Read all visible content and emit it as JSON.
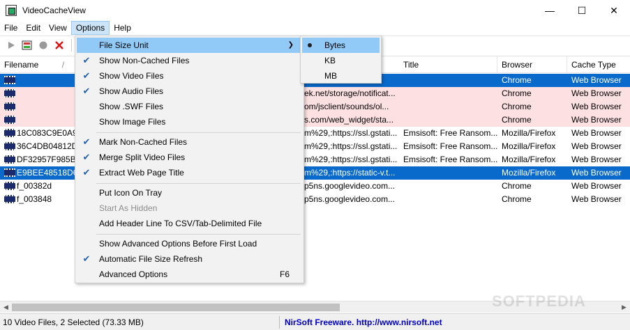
{
  "window": {
    "title": "VideoCacheView",
    "controls": {
      "minimize": "—",
      "maximize": "☐",
      "close": "✕"
    }
  },
  "menubar": {
    "items": [
      "File",
      "Edit",
      "View",
      "Options",
      "Help"
    ],
    "active": "Options"
  },
  "toolbar": {
    "icons": [
      "play-icon",
      "save-icon",
      "stop-icon",
      "delete-icon"
    ]
  },
  "table": {
    "columns": [
      "Filename",
      "Title",
      "Browser",
      "Cache Type"
    ],
    "sort_indicator": "/",
    "rows": [
      {
        "filename": "",
        "url": "m...",
        "title": "",
        "browser": "Chrome",
        "cache_type": "Web Browser",
        "state": "selected"
      },
      {
        "filename": "",
        "url": "ek.net/storage/notificat...",
        "title": "",
        "browser": "Chrome",
        "cache_type": "Web Browser",
        "state": "pink"
      },
      {
        "filename": "",
        "url": "om/jsclient/sounds/ol...",
        "title": "",
        "browser": "Chrome",
        "cache_type": "Web Browser",
        "state": "pink"
      },
      {
        "filename": "",
        "url": "s.com/web_widget/sta...",
        "title": "",
        "browser": "Chrome",
        "cache_type": "Web Browser",
        "state": "pink"
      },
      {
        "filename": "18C083C9E0A92",
        "url": "m%29,:https://ssl.gstati...",
        "title": "Emsisoft: Free Ransom...",
        "browser": "Mozilla/Firefox",
        "cache_type": "Web Browser",
        "state": "normal"
      },
      {
        "filename": "36C4DB04812D0",
        "url": "m%29,:https://ssl.gstati...",
        "title": "Emsisoft: Free Ransom...",
        "browser": "Mozilla/Firefox",
        "cache_type": "Web Browser",
        "state": "normal"
      },
      {
        "filename": "DF32957F985B5",
        "url": "m%29,:https://ssl.gstati...",
        "title": "Emsisoft: Free Ransom...",
        "browser": "Mozilla/Firefox",
        "cache_type": "Web Browser",
        "state": "normal"
      },
      {
        "filename": "E9BEE48518D6A",
        "url": "m%29,:https://static-v.t...",
        "title": "",
        "browser": "Mozilla/Firefox",
        "cache_type": "Web Browser",
        "state": "selected"
      },
      {
        "filename": "f_00382d",
        "url": "p5ns.googlevideo.com...",
        "title": "",
        "browser": "Chrome",
        "cache_type": "Web Browser",
        "state": "normal"
      },
      {
        "filename": "f_003848",
        "url": "p5ns.googlevideo.com...",
        "title": "",
        "browser": "Chrome",
        "cache_type": "Web Browser",
        "state": "normal"
      }
    ]
  },
  "options_menu": {
    "items": [
      {
        "label": "File Size Unit",
        "checked": false,
        "submenu": true,
        "highlighted": true
      },
      {
        "label": "Show Non-Cached Files",
        "checked": true
      },
      {
        "label": "Show Video Files",
        "checked": true
      },
      {
        "label": "Show Audio Files",
        "checked": true
      },
      {
        "label": "Show .SWF Files",
        "checked": false
      },
      {
        "label": "Show Image Files",
        "checked": false
      },
      {
        "label": "Mark Non-Cached Files",
        "checked": true
      },
      {
        "label": "Merge Split Video Files",
        "checked": true
      },
      {
        "label": "Extract Web Page Title",
        "checked": true
      },
      {
        "label": "Put Icon On Tray",
        "checked": false
      },
      {
        "label": "Start As Hidden",
        "checked": false,
        "disabled": true
      },
      {
        "label": "Add Header Line To CSV/Tab-Delimited File",
        "checked": false
      },
      {
        "label": "Show Advanced Options Before First Load",
        "checked": false
      },
      {
        "label": "Automatic File Size Refresh",
        "checked": true
      },
      {
        "label": "Advanced Options",
        "checked": false,
        "accelerator": "F6"
      }
    ]
  },
  "size_unit_submenu": {
    "items": [
      {
        "label": "Bytes",
        "selected": true
      },
      {
        "label": "KB",
        "selected": false
      },
      {
        "label": "MB",
        "selected": false
      }
    ]
  },
  "statusbar": {
    "summary": "10 Video Files, 2 Selected  (73.33 MB)",
    "link": "NirSoft Freeware.  http://www.nirsoft.net"
  },
  "watermark": "SOFTPEDIA",
  "colors": {
    "selection": "#0a6acc",
    "pink_row": "#fde0e2",
    "menu_highlight": "#91c9f7",
    "check": "#2461ad",
    "link": "#0000cc"
  }
}
